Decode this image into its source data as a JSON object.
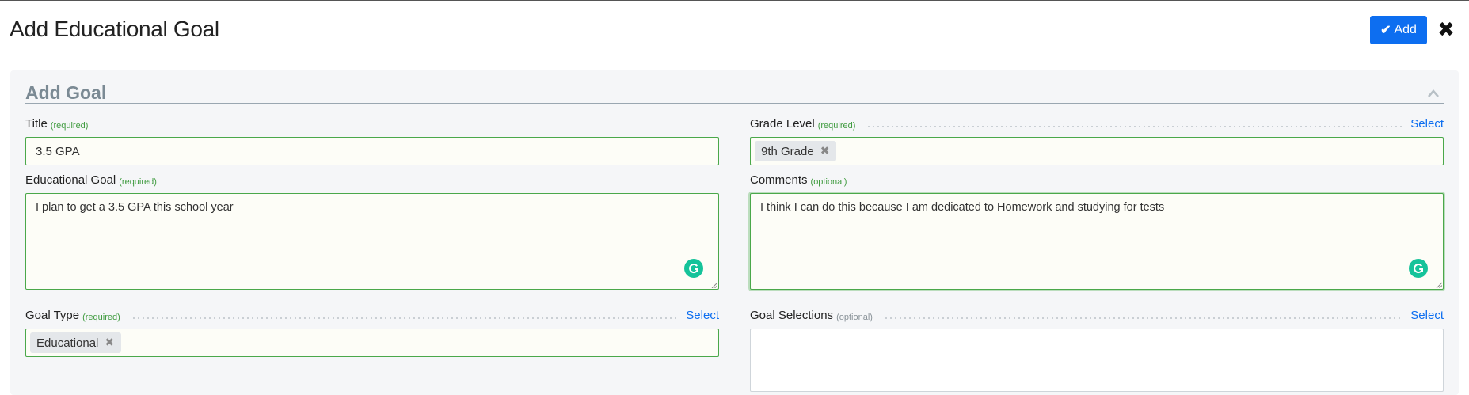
{
  "header": {
    "title": "Add Educational Goal",
    "add_label": "Add",
    "check_icon": "✔",
    "close_icon": "✖"
  },
  "panel": {
    "title": "Add Goal"
  },
  "fields": {
    "title": {
      "label": "Title",
      "hint": "(required)",
      "value": "3.5 GPA"
    },
    "grade_level": {
      "label": "Grade Level",
      "hint": "(required)",
      "select": "Select",
      "tag": "9th Grade",
      "remove": "✖"
    },
    "educational_goal": {
      "label": "Educational Goal",
      "hint": "(required)",
      "value": "I plan to get a 3.5 GPA this school year"
    },
    "comments": {
      "label": "Comments",
      "hint": "(optional)",
      "value": "I think I can do this because I am dedicated to Homework and studying for tests"
    },
    "goal_type": {
      "label": "Goal Type",
      "hint": "(required)",
      "select": "Select",
      "tag": "Educational",
      "remove": "✖"
    },
    "goal_selections": {
      "label": "Goal Selections",
      "hint": "(optional)",
      "select": "Select"
    }
  },
  "colors": {
    "primary": "#0d6ef0",
    "required": "#3f9b3f",
    "input_border": "#4aa84a",
    "grammarly": "#15c39a"
  }
}
